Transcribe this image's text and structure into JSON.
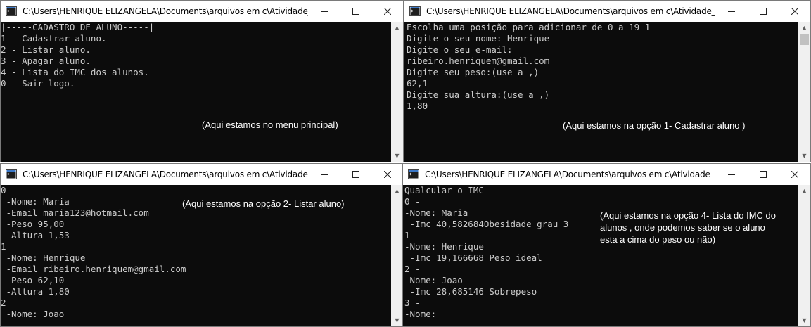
{
  "windows": {
    "w1": {
      "title": "C:\\Users\\HENRIQUE ELIZANGELA\\Documents\\arquivos em c\\Atividade_C\\...",
      "lines": [
        "",
        "|-----CADASTRO DE ALUNO-----|",
        "",
        "1 - Cadastrar aluno.",
        "2 - Listar aluno.",
        "3 - Apagar aluno.",
        "4 - Lista do IMC dos alunos.",
        "0 - Sair logo."
      ],
      "note": "(Aqui estamos no menu principal)"
    },
    "w2": {
      "title": "C:\\Users\\HENRIQUE ELIZANGELA\\Documents\\arquivos em c\\Atividade_C\\...",
      "lines": [
        "Escolha uma posição para adicionar de 0 a 19 1",
        "Digite o seu nome: Henrique",
        "Digite o seu e-mail:",
        "ribeiro.henriquem@gmail.com",
        "Digite seu peso:(use a ,)",
        "62,1",
        "Digite sua altura:(use a ,)",
        "1,80"
      ],
      "note": "(Aqui estamos na opção 1- Cadastrar aluno )"
    },
    "w3": {
      "title": "C:\\Users\\HENRIQUE ELIZANGELA\\Documents\\arquivos em c\\Atividade_C\\...",
      "lines": [
        "0",
        " -Nome: Maria",
        " -Email maria123@hotmail.com",
        " -Peso 95,00",
        " -Altura 1,53",
        "1",
        " -Nome: Henrique",
        " -Email ribeiro.henriquem@gmail.com",
        " -Peso 62,10",
        " -Altura 1,80",
        "2",
        " -Nome: Joao"
      ],
      "note": "(Aqui estamos na opção 2- Listar aluno)"
    },
    "w4": {
      "title": "C:\\Users\\HENRIQUE ELIZANGELA\\Documents\\arquivos em c\\Atividade_C\\...",
      "lines": [
        "Qualcular o IMC",
        "0 -",
        "-Nome: Maria",
        " -Imc 40,582684Obesidade grau 3",
        "1 -",
        "-Nome: Henrique",
        " -Imc 19,166668 Peso ideal",
        "2 -",
        "-Nome: Joao",
        " -Imc 28,685146 Sobrepeso",
        "3 -",
        "-Nome:"
      ],
      "note": "(Aqui estamos na opção 4- Lista do IMC do\nalunos , onde podemos saber se o aluno\nesta a cima do peso ou não)"
    }
  }
}
